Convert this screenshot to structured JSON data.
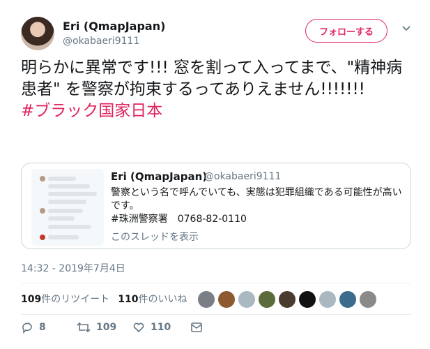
{
  "author": {
    "name": "Eri (QmapJapan)",
    "handle": "@okabaeri9111",
    "follow_label": "フォローする"
  },
  "tweet": {
    "text": "明らかに異常です!!! 窓を割って入ってまで、\"精神病患者\" を警察が拘束するってありえません!!!!!!!",
    "hashtag": "#ブラック国家日本"
  },
  "quoted": {
    "name": "Eri (QmapJapan)",
    "handle": "@okabaeri9111",
    "text_line1": "警察という名で呼んでいても、実態は犯罪組織である可能性が高いです。",
    "text_line2": "#珠洲警察署　0768-82-0110",
    "thread_link": "このスレッドを表示"
  },
  "timestamp": "14:32 - 2019年7月4日",
  "stats": {
    "retweets_count": "109",
    "retweets_label": "件のリツイート",
    "likes_count": "110",
    "likes_label": "件のいいね"
  },
  "actions": {
    "reply_count": "8",
    "retweet_count": "109",
    "like_count": "110"
  },
  "colors": {
    "accent": "#e0245e",
    "muted": "#657786",
    "text": "#14171a"
  },
  "icons": [
    "chevron-down-icon",
    "reply-icon",
    "retweet-icon",
    "heart-icon",
    "message-icon"
  ]
}
